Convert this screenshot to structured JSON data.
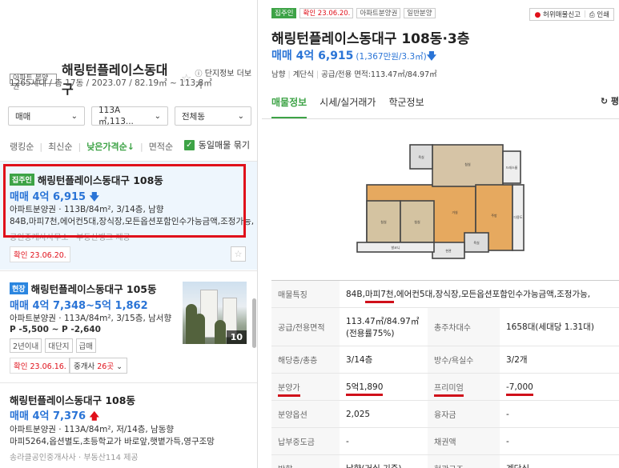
{
  "complex": {
    "type_tag": "아파트 분양권",
    "name": "해링턴플레이스동대구",
    "detail_link": "단지정보 더보기",
    "info": "1265세대 / 총 17동 / 2023.07 / 82.19㎡ ~ 113.8㎡"
  },
  "filters": {
    "trade": "매매",
    "area": "113A㎡,113...",
    "building": "전체동"
  },
  "sorts": {
    "rank": "랭킹순",
    "latest": "최신순",
    "low_price": "낮은가격순",
    "low_price_arrow": "↓",
    "area": "면적순",
    "group_label": "동일매물 묶기"
  },
  "listings": [
    {
      "badge": "집주인",
      "title": "해링턴플레이스동대구 108동",
      "price": "매매 4억 6,915",
      "spec": "아파트분양권 · 113B/84m², 3/14층, 남향",
      "desc": "84B,마피7천,에어컨5대,장식장,모든옵션포함인수가능금액,조정가능,",
      "agent": "공인중개사사무소 · 부동산뱅크 제공",
      "confirm": "확인 23.06.20."
    },
    {
      "badge": "현장",
      "title": "해링턴플레이스동대구 105동",
      "price": "매매 4억 7,348~5억 1,862",
      "spec": "아파트분양권 · 113A/84m², 3/15층, 남서향",
      "desc": "P -5,500 ~ P -2,640",
      "tags": [
        "2년이내",
        "대단지",
        "급매"
      ],
      "photo_count": "10",
      "confirm": "확인 23.06.16.",
      "agents_label": "중개사",
      "agents_count": "26곳"
    },
    {
      "title": "해링턴플레이스동대구 108동",
      "price": "매매 4억 7,376",
      "spec": "아파트분양권 · 113A/84m², 저/14층, 남동향",
      "desc": "마피5264,옵션별도,초등학교가 바로앞,햇볕가득,영구조망",
      "agent": "송라클공인중개사사 · 부동산114 제공"
    }
  ],
  "detail": {
    "tags": [
      "집주인",
      "확인 23.06.20.",
      "아파트분양권",
      "일반분양"
    ],
    "report": "허위매물신고",
    "print": "인쇄",
    "title": "해링턴플레이스동대구 108동·3층",
    "price": "매매 4억 6,915",
    "price_sub": "(1,367만원/3.3㎡)",
    "meta": [
      "남향",
      "계단식",
      "공급/전용 면적:113.47㎡/84.97㎡"
    ],
    "tabs": [
      "매물정보",
      "시세/실거래가",
      "학군정보"
    ],
    "refresh": "평",
    "plan_rooms": [
      "침실",
      "침실",
      "침실",
      "거실",
      "주방",
      "욕실",
      "욕실",
      "드레스룸",
      "발코니",
      "다용도",
      "현관"
    ],
    "rows": {
      "feature_k": "매물특징",
      "feature_v_pre": "84B,",
      "feature_v_mark": "마피7천",
      "feature_v_post": ",에어컨5대,장식장,모든옵션포함인수가능금액,조정가능,",
      "area_k": "공급/전용면적",
      "area_v": "113.47㎡/84.97㎡(전용률75%)",
      "households_k": "총주차대수",
      "households_v": "1658대(세대당 1.31대)",
      "floor_k": "해당층/총층",
      "floor_v": "3/14층",
      "rooms_k": "방수/욕실수",
      "rooms_v": "3/2개",
      "sale_k": "분양가",
      "sale_v": "5억1,890",
      "premium_k": "프리미엄",
      "premium_v": "-7,000",
      "option_k": "분양옵션",
      "option_v": "2,025",
      "loan_k": "융자금",
      "loan_v": "-",
      "mid_k": "납부중도금",
      "mid_v": "-",
      "rights_k": "채권액",
      "rights_v": "-",
      "dir_k": "방향",
      "dir_v": "남향(거실 기준)",
      "struct_k": "현관구조",
      "struct_v": "계단식"
    }
  }
}
